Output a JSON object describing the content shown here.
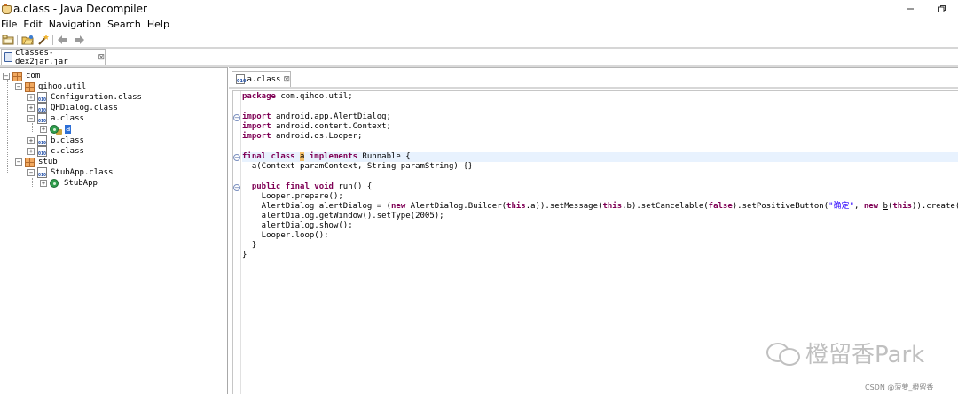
{
  "window": {
    "title": "a.class - Java Decompiler",
    "minimize_icon": "minimize-icon",
    "restore_icon": "restore-icon"
  },
  "menu": [
    "File",
    "Edit",
    "Navigation",
    "Search",
    "Help"
  ],
  "toolbar": {
    "icons": [
      "open-file-icon",
      "open-folder-icon",
      "wand-icon",
      "back-arrow-icon",
      "forward-arrow-icon"
    ]
  },
  "jar_tab": {
    "label": "classes-dex2jar.jar",
    "close": "⊠"
  },
  "tree": [
    {
      "label": "com",
      "kind": "package",
      "expander": "−"
    },
    {
      "label": "qihoo.util",
      "kind": "package",
      "expander": "−"
    },
    {
      "label": "Configuration.class",
      "kind": "class-file",
      "expander": "+"
    },
    {
      "label": "QHDialog.class",
      "kind": "class-file",
      "expander": "+"
    },
    {
      "label": "a.class",
      "kind": "class-file",
      "expander": "−"
    },
    {
      "label": "a",
      "kind": "class",
      "expander": "+",
      "selected": true
    },
    {
      "label": "b.class",
      "kind": "class-file",
      "expander": "+"
    },
    {
      "label": "c.class",
      "kind": "class-file",
      "expander": "+"
    },
    {
      "label": "stub",
      "kind": "package",
      "expander": "−"
    },
    {
      "label": "StubApp.class",
      "kind": "class-file",
      "expander": "−"
    },
    {
      "label": "StubApp",
      "kind": "class",
      "expander": "+"
    }
  ],
  "editor_tab": {
    "label": "a.class",
    "close": "⊠"
  },
  "code": [
    "package com.qihoo.util;",
    "",
    "import android.app.AlertDialog;",
    "import android.content.Context;",
    "import android.os.Looper;",
    "",
    "final class a implements Runnable {",
    "  a(Context paramContext, String paramString) {}",
    "",
    "  public final void run() {",
    "    Looper.prepare();",
    "    AlertDialog alertDialog = (new AlertDialog.Builder(this.a)).setMessage(this.b).setCancelable(false).setPositiveButton(\"确定\", new b(this)).create(",
    "    alertDialog.getWindow().setType(2005);",
    "    alertDialog.show();",
    "    Looper.loop();",
    "  }",
    "}"
  ],
  "watermark": {
    "text": "橙留香Park",
    "credit": "CSDN @菠萝_橙留香"
  }
}
